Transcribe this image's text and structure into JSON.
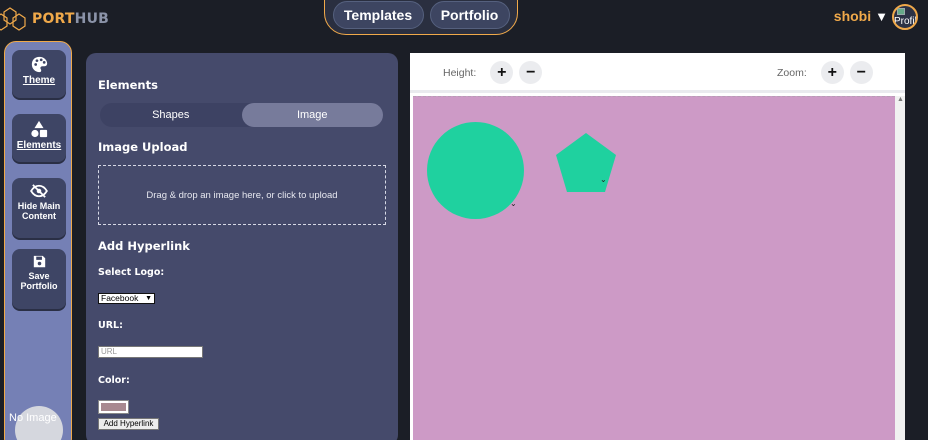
{
  "header": {
    "logo_part1": "PORT",
    "logo_part2": "HUB",
    "nav": [
      "Templates",
      "Portfolio"
    ],
    "username": "shobi",
    "caret": "▼",
    "profile_alt": "Profil"
  },
  "sidebar": {
    "items": [
      {
        "label": "Theme",
        "icon": "palette-icon"
      },
      {
        "label": "Elements",
        "icon": "shapes-icon"
      },
      {
        "label": "Hide Main Content",
        "icon": "eye-slash-icon"
      },
      {
        "label": "Save Portfolio",
        "icon": "floppy-disk-icon"
      }
    ],
    "avatar_alt": "No Image"
  },
  "panel": {
    "title": "Elements",
    "tabs": [
      "Shapes",
      "Image"
    ],
    "active_tab": "Image",
    "upload_heading": "Image Upload",
    "dropzone_text": "Drag & drop an image here, or click to upload",
    "hyperlink_heading": "Add Hyperlink",
    "select_logo_label": "Select Logo:",
    "logo_value": "Facebook",
    "url_label": "URL:",
    "url_placeholder": "URL",
    "color_label": "Color:",
    "color_value": "#a88990",
    "add_button": "Add Hyperlink"
  },
  "canvas": {
    "height_label": "Height:",
    "zoom_label": "Zoom:",
    "plus": "+",
    "minus": "−",
    "background": "#cd9ac6",
    "shape_color": "#1fd19f",
    "shapes": [
      "circle",
      "pentagon"
    ],
    "handle_glyph": "⌄"
  },
  "colors": {
    "accent": "#f0a94a",
    "sidebar": "#7580b5",
    "panel": "#454a6b"
  }
}
